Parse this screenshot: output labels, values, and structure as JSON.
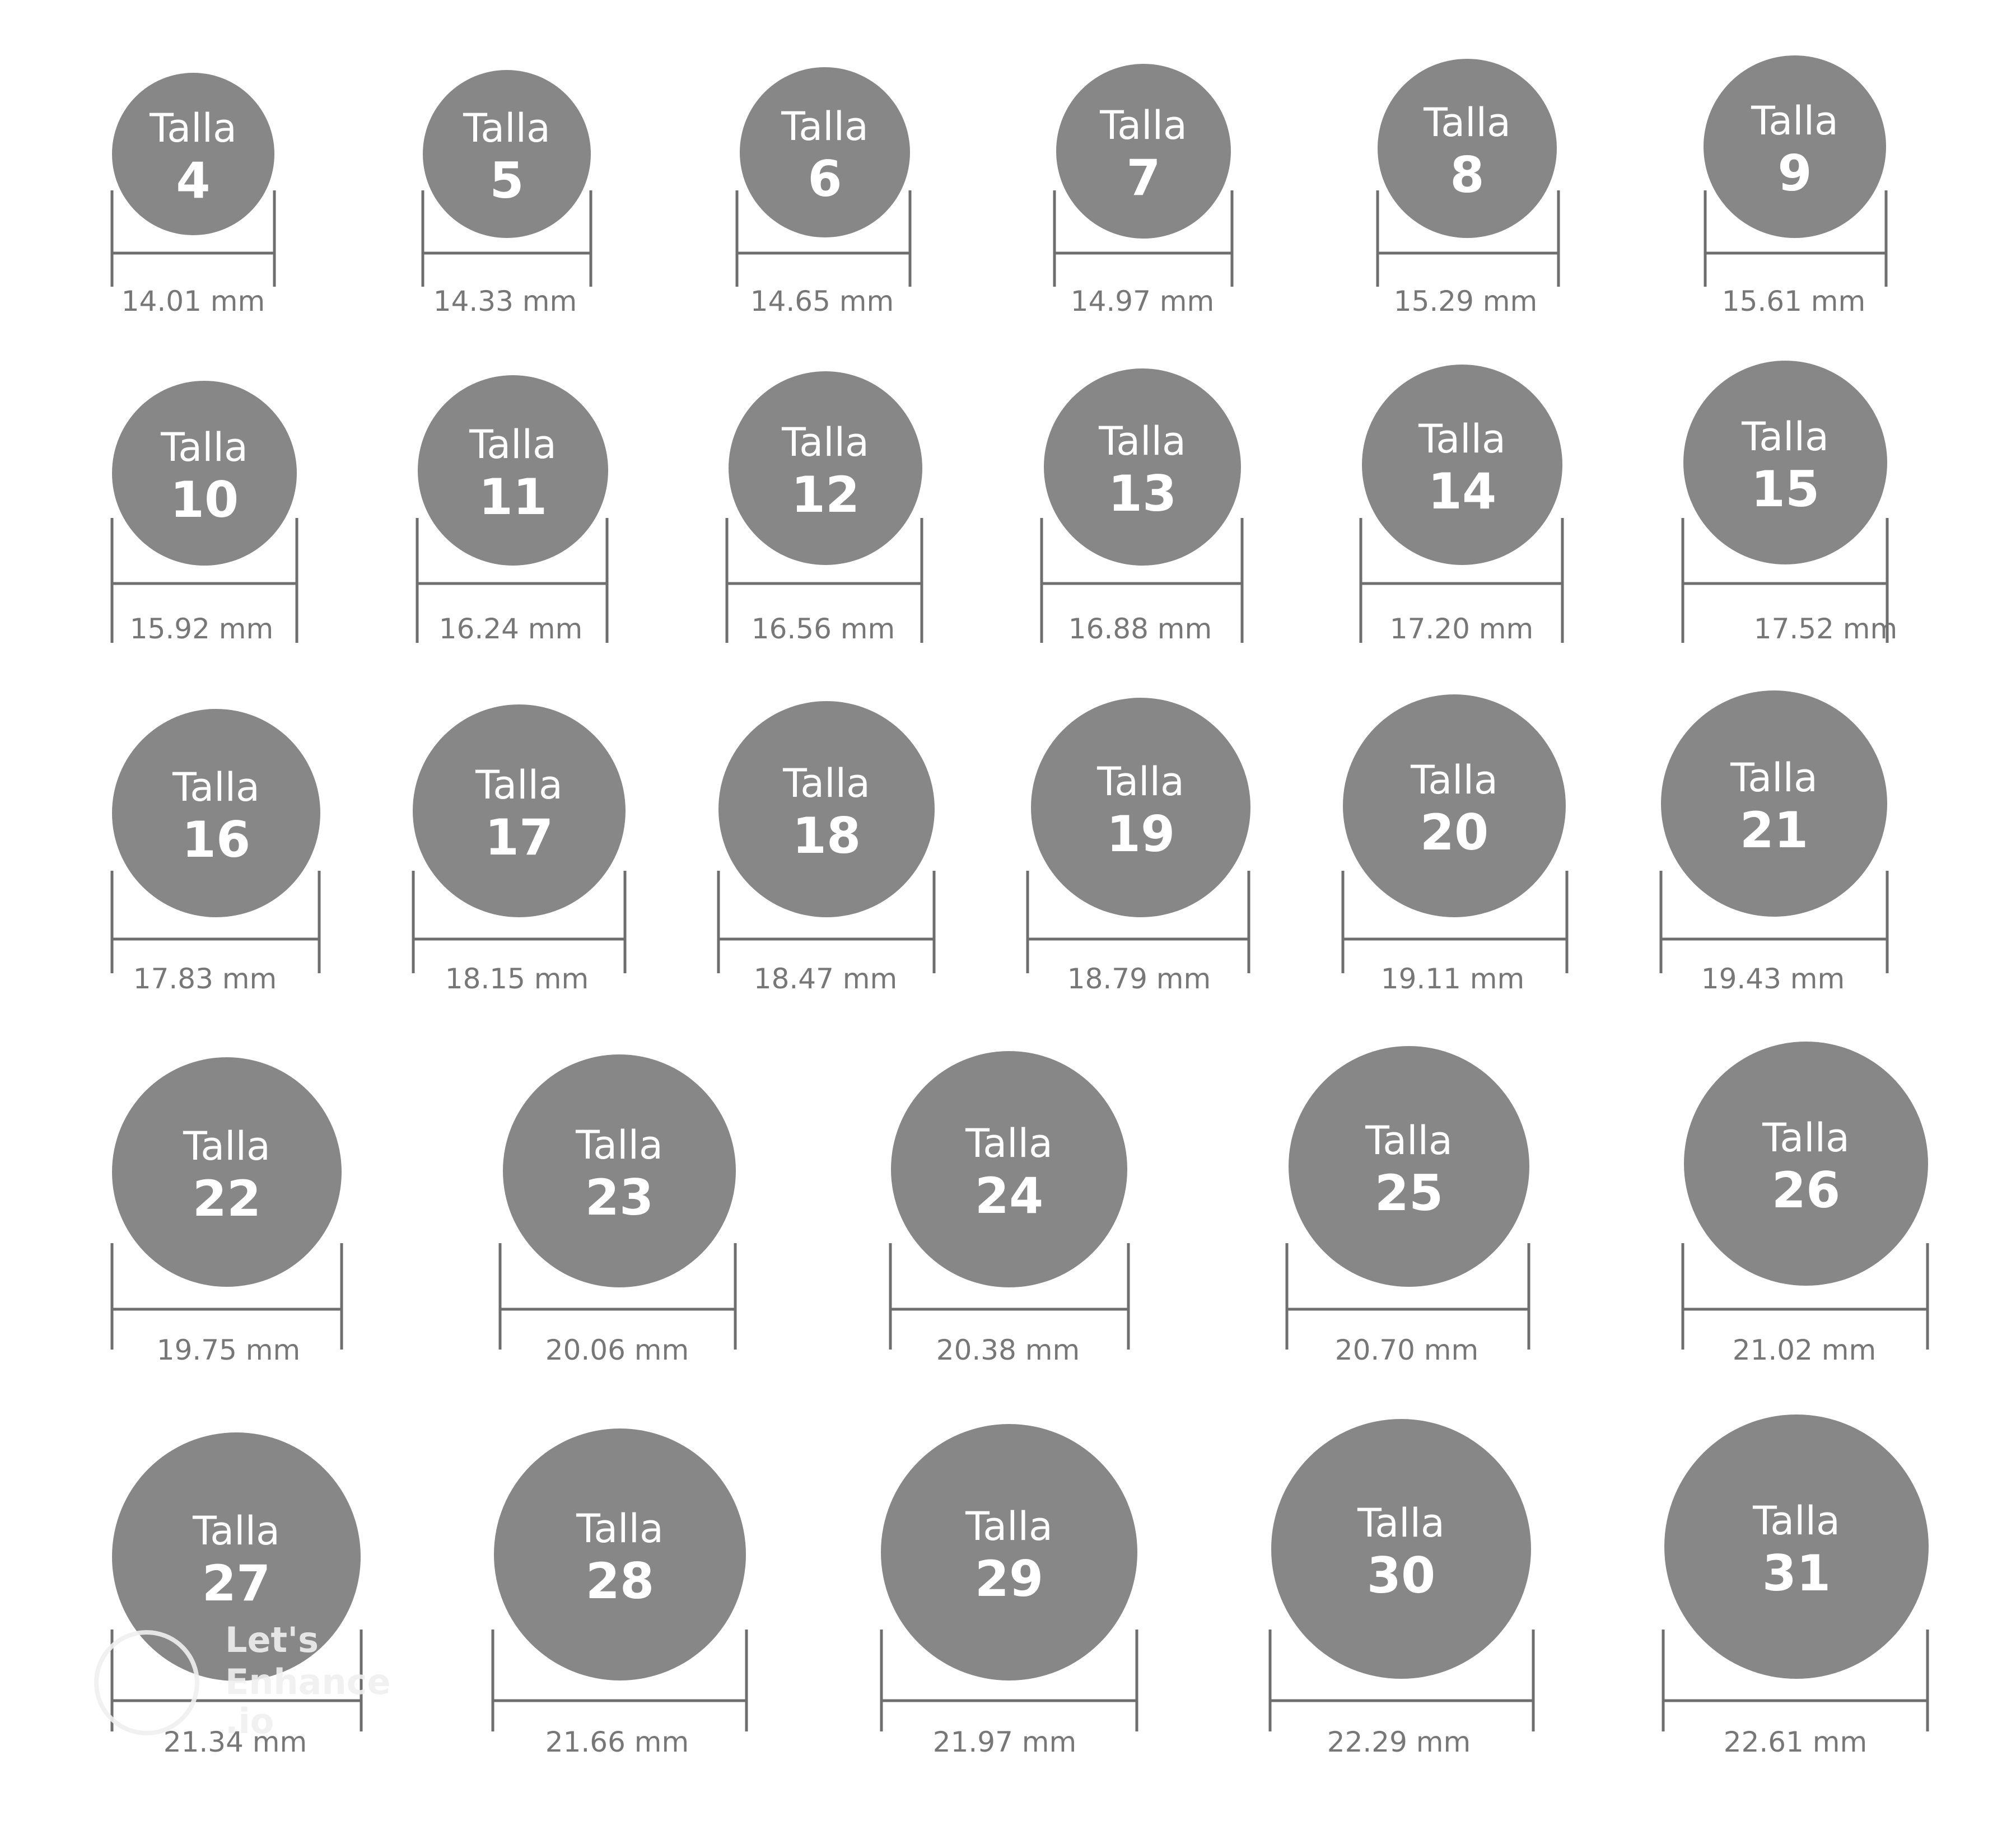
{
  "chart_data": {
    "type": "diagram",
    "label_word": "Talla",
    "unit": "mm",
    "colors": {
      "circle": "#878787",
      "text_on_circle": "#ffffff",
      "measurement_text": "#777777",
      "lines": "#6e6e6e"
    },
    "sizes": [
      {
        "talla": "4",
        "diameter": "14.01 mm"
      },
      {
        "talla": "5",
        "diameter": "14.33 mm"
      },
      {
        "talla": "6",
        "diameter": "14.65 mm"
      },
      {
        "talla": "7",
        "diameter": "14.97 mm"
      },
      {
        "talla": "8",
        "diameter": "15.29 mm"
      },
      {
        "talla": "9",
        "diameter": "15.61 mm"
      },
      {
        "talla": "10",
        "diameter": "15.92 mm"
      },
      {
        "talla": "11",
        "diameter": "16.24 mm"
      },
      {
        "talla": "12",
        "diameter": "16.56 mm"
      },
      {
        "talla": "13",
        "diameter": "16.88 mm"
      },
      {
        "talla": "14",
        "diameter": "17.20 mm"
      },
      {
        "talla": "15",
        "diameter": "17.52 mm"
      },
      {
        "talla": "16",
        "diameter": "17.83 mm"
      },
      {
        "talla": "17",
        "diameter": "18.15 mm"
      },
      {
        "talla": "18",
        "diameter": "18.47 mm"
      },
      {
        "talla": "19",
        "diameter": "18.79 mm"
      },
      {
        "talla": "20",
        "diameter": "19.11 mm"
      },
      {
        "talla": "21",
        "diameter": "19.43 mm"
      },
      {
        "talla": "22",
        "diameter": "19.75 mm"
      },
      {
        "talla": "23",
        "diameter": "20.06 mm"
      },
      {
        "talla": "24",
        "diameter": "20.38 mm"
      },
      {
        "talla": "25",
        "diameter": "20.70 mm"
      },
      {
        "talla": "26",
        "diameter": "21.02 mm"
      },
      {
        "talla": "27",
        "diameter": "21.34 mm"
      },
      {
        "talla": "28",
        "diameter": "21.66 mm"
      },
      {
        "talla": "29",
        "diameter": "21.97 mm"
      },
      {
        "talla": "30",
        "diameter": "22.29 mm"
      },
      {
        "talla": "31",
        "diameter": "22.61 mm"
      }
    ]
  },
  "watermark": {
    "line1": "Let's",
    "line2": "Enhance",
    "line3": ".io"
  }
}
